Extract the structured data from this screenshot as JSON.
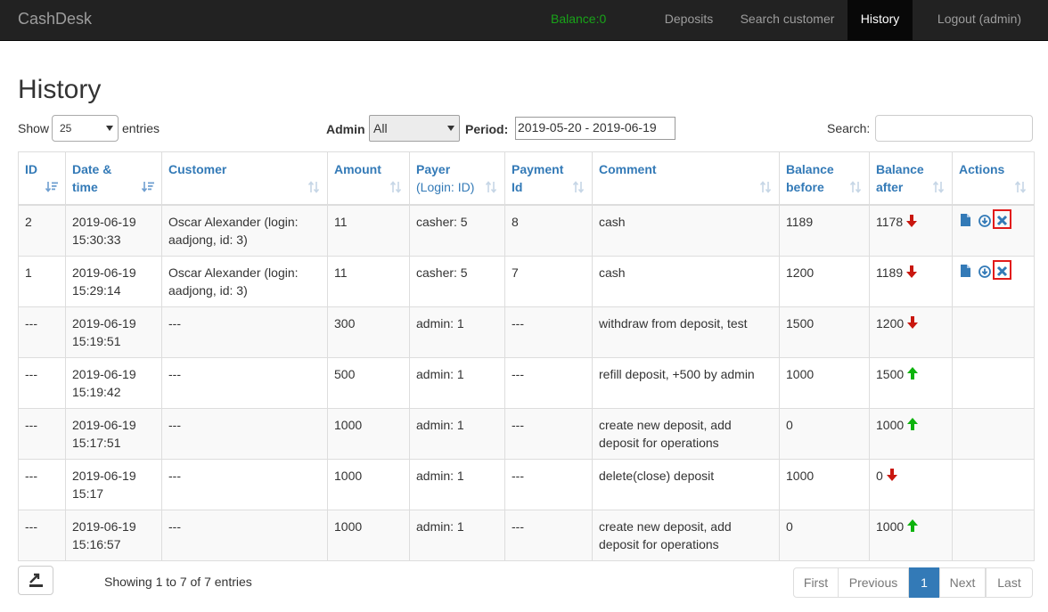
{
  "app": {
    "brand": "CashDesk",
    "balance": "Balance:0",
    "nav": {
      "deposits": "Deposits",
      "search_customer": "Search customer",
      "history": "History",
      "logout": "Logout (admin)"
    }
  },
  "page": {
    "title": "History"
  },
  "controls": {
    "show_label": "Show",
    "show_value": "25",
    "entries_label": "entries",
    "admin_label": "Admin",
    "admin_value": "All",
    "period_label": "Period:",
    "period_value": "2019-05-20 - 2019-06-19",
    "search_label": "Search:",
    "search_value": ""
  },
  "table": {
    "headers": {
      "id": "ID",
      "datetime_1": "Date &",
      "datetime_2": "time",
      "customer": "Customer",
      "amount": "Amount",
      "payer_1": "Payer",
      "payer_2": "(Login: ID)",
      "payment_1": "Payment",
      "payment_2": "Id",
      "comment": "Comment",
      "before_1": "Balance",
      "before_2": "before",
      "after_1": "Balance",
      "after_2": "after",
      "actions": "Actions"
    },
    "rows": [
      {
        "id": "2",
        "date": "2019-06-19",
        "time": "15:30:33",
        "customer_1": "Oscar Alexander (login:",
        "customer_2": "aadjong, id: 3)",
        "amount": "11",
        "payer": "casher: 5",
        "payment_id": "8",
        "comment_1": "cash",
        "comment_2": "",
        "before": "1189",
        "after": "1178",
        "direction": "down",
        "has_actions": true
      },
      {
        "id": "1",
        "date": "2019-06-19",
        "time": "15:29:14",
        "customer_1": "Oscar Alexander (login:",
        "customer_2": "aadjong, id: 3)",
        "amount": "11",
        "payer": "casher: 5",
        "payment_id": "7",
        "comment_1": "cash",
        "comment_2": "",
        "before": "1200",
        "after": "1189",
        "direction": "down",
        "has_actions": true
      },
      {
        "id": "---",
        "date": "2019-06-19",
        "time": "15:19:51",
        "customer_1": "---",
        "customer_2": "",
        "amount": "300",
        "payer": "admin: 1",
        "payment_id": "---",
        "comment_1": "withdraw from deposit, test",
        "comment_2": "",
        "before": "1500",
        "after": "1200",
        "direction": "down",
        "has_actions": false
      },
      {
        "id": "---",
        "date": "2019-06-19",
        "time": "15:19:42",
        "customer_1": "---",
        "customer_2": "",
        "amount": "500",
        "payer": "admin: 1",
        "payment_id": "---",
        "comment_1": "refill deposit, +500 by admin",
        "comment_2": "",
        "before": "1000",
        "after": "1500",
        "direction": "up",
        "has_actions": false
      },
      {
        "id": "---",
        "date": "2019-06-19",
        "time": "15:17:51",
        "customer_1": "---",
        "customer_2": "",
        "amount": "1000",
        "payer": "admin: 1",
        "payment_id": "---",
        "comment_1": "create new deposit, add",
        "comment_2": "deposit for operations",
        "before": "0",
        "after": "1000",
        "direction": "up",
        "has_actions": false
      },
      {
        "id": "---",
        "date": "2019-06-19",
        "time": "15:17",
        "customer_1": "---",
        "customer_2": "",
        "amount": "1000",
        "payer": "admin: 1",
        "payment_id": "---",
        "comment_1": "delete(close) deposit",
        "comment_2": "",
        "before": "1000",
        "after": "0",
        "direction": "down",
        "has_actions": false
      },
      {
        "id": "---",
        "date": "2019-06-19",
        "time": "15:16:57",
        "customer_1": "---",
        "customer_2": "",
        "amount": "1000",
        "payer": "admin: 1",
        "payment_id": "---",
        "comment_1": "create new deposit, add",
        "comment_2": "deposit for operations",
        "before": "0",
        "after": "1000",
        "direction": "up",
        "has_actions": false
      }
    ]
  },
  "footer": {
    "info": "Showing 1 to 7 of 7 entries",
    "pagination": {
      "first": "First",
      "previous": "Previous",
      "current": "1",
      "next": "Next",
      "last": "Last"
    }
  },
  "icons": {
    "export": "export-icon",
    "document": "document-icon",
    "download": "download-circle-icon",
    "delete": "close-icon",
    "up": "arrow-up-icon",
    "down": "arrow-down-icon"
  },
  "colors": {
    "navbar": "#222222",
    "balance": "#19a319",
    "link": "#337ab7",
    "arrow_down": "#c9170f",
    "arrow_up": "#0db30d",
    "highlight": "#e21a1a"
  }
}
